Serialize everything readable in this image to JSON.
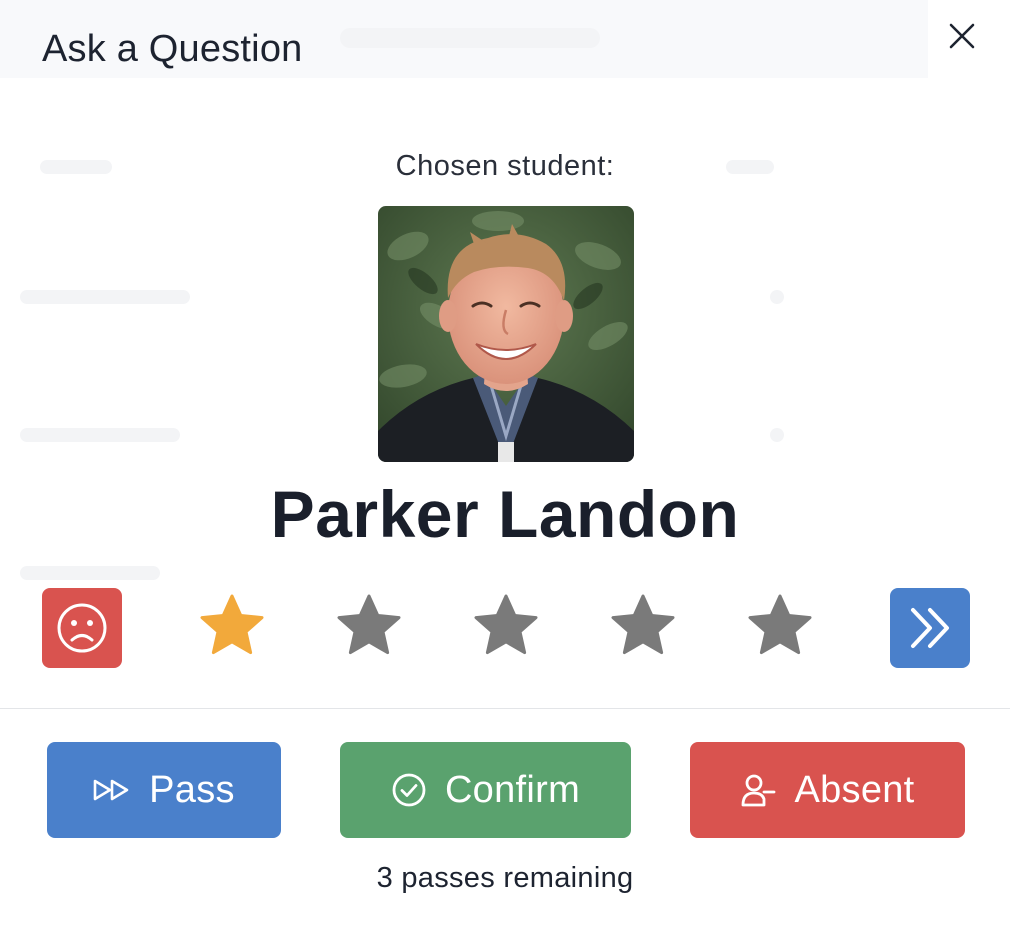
{
  "modal": {
    "title": "Ask a Question",
    "close_icon": "close-icon"
  },
  "student": {
    "chosen_label": "Chosen student:",
    "name": "Parker Landon",
    "photo": "student-photo"
  },
  "rating": {
    "sad_icon": "sad-face-icon",
    "value": 1,
    "max": 5,
    "star_icon": "star-icon",
    "skip_icon": "double-chevron-right-icon"
  },
  "actions": {
    "pass_label": "Pass",
    "pass_icon": "fast-forward-icon",
    "confirm_label": "Confirm",
    "confirm_icon": "check-circle-icon",
    "absent_label": "Absent",
    "absent_icon": "user-minus-icon"
  },
  "status": {
    "passes_remaining": "3 passes remaining"
  },
  "colors": {
    "primary_blue": "#4a80cb",
    "success_green": "#5aa26e",
    "danger_red": "#d9534f",
    "star_active": "#f2a93b",
    "star_inactive": "#7a7a7a"
  }
}
